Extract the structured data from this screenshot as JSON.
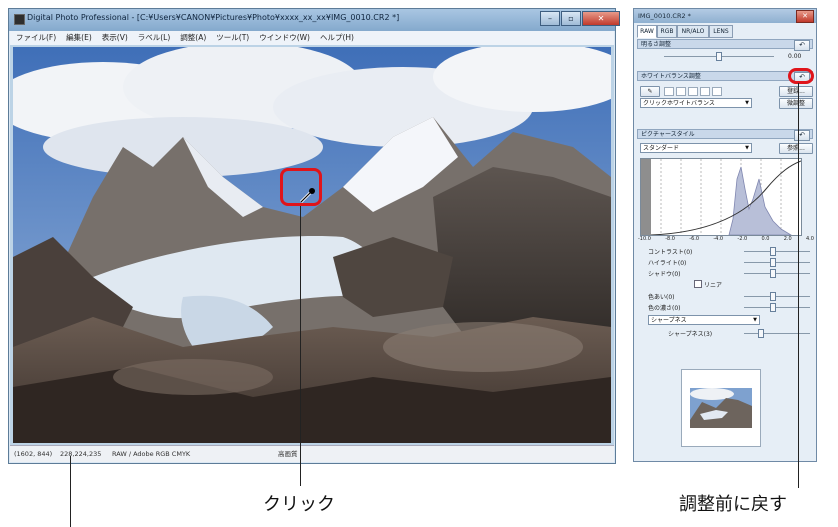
{
  "main_window": {
    "title": "Digital Photo Professional - [C:¥Users¥CANON¥Pictures¥Photo¥xxxx_xx_xx¥IMG_0010.CR2 *]",
    "menu": [
      "ファイル(F)",
      "編集(E)",
      "表示(V)",
      "ラベル(L)",
      "調整(A)",
      "ツール(T)",
      "ウインドウ(W)",
      "ヘルプ(H)"
    ],
    "status": {
      "coords": "(1602, 844)",
      "rgb": "228,224,235",
      "color_info": "RAW / Adobe RGB  CMYK",
      "mode": "高画質"
    }
  },
  "tool_palette": {
    "title": "IMG_0010.CR2 *",
    "tabs": [
      "RAW",
      "RGB",
      "NR/ALO",
      "LENS"
    ],
    "brightness": {
      "label": "明るさ調整",
      "value": "0.00"
    },
    "white_balance": {
      "label": "ホワイトバランス調整",
      "register_button": "登録...",
      "select": "クリックホワイトバランス",
      "fine_tune_button": "微調整"
    },
    "picture_style": {
      "label": "ピクチャースタイル",
      "select": "スタンダード",
      "browse_button": "参照..."
    },
    "histogram_ticks": [
      "-10.0",
      "-8.0",
      "-6.0",
      "-4.0",
      "-2.0",
      "0.0",
      "2.0",
      "4.0"
    ],
    "params": {
      "contrast": "コントラスト(0)",
      "highlight": "ハイライト(0)",
      "shadow": "シャドウ(0)",
      "linear": "リニア",
      "hue": "色あい(0)",
      "saturation": "色の濃さ(0)",
      "sharpness_select": "シャープネス",
      "sharpness": "シャープネス(3)"
    }
  },
  "captions": {
    "click": "クリック",
    "reset": "調整前に戻す"
  },
  "colors": {
    "highlight": "#e0141a"
  }
}
